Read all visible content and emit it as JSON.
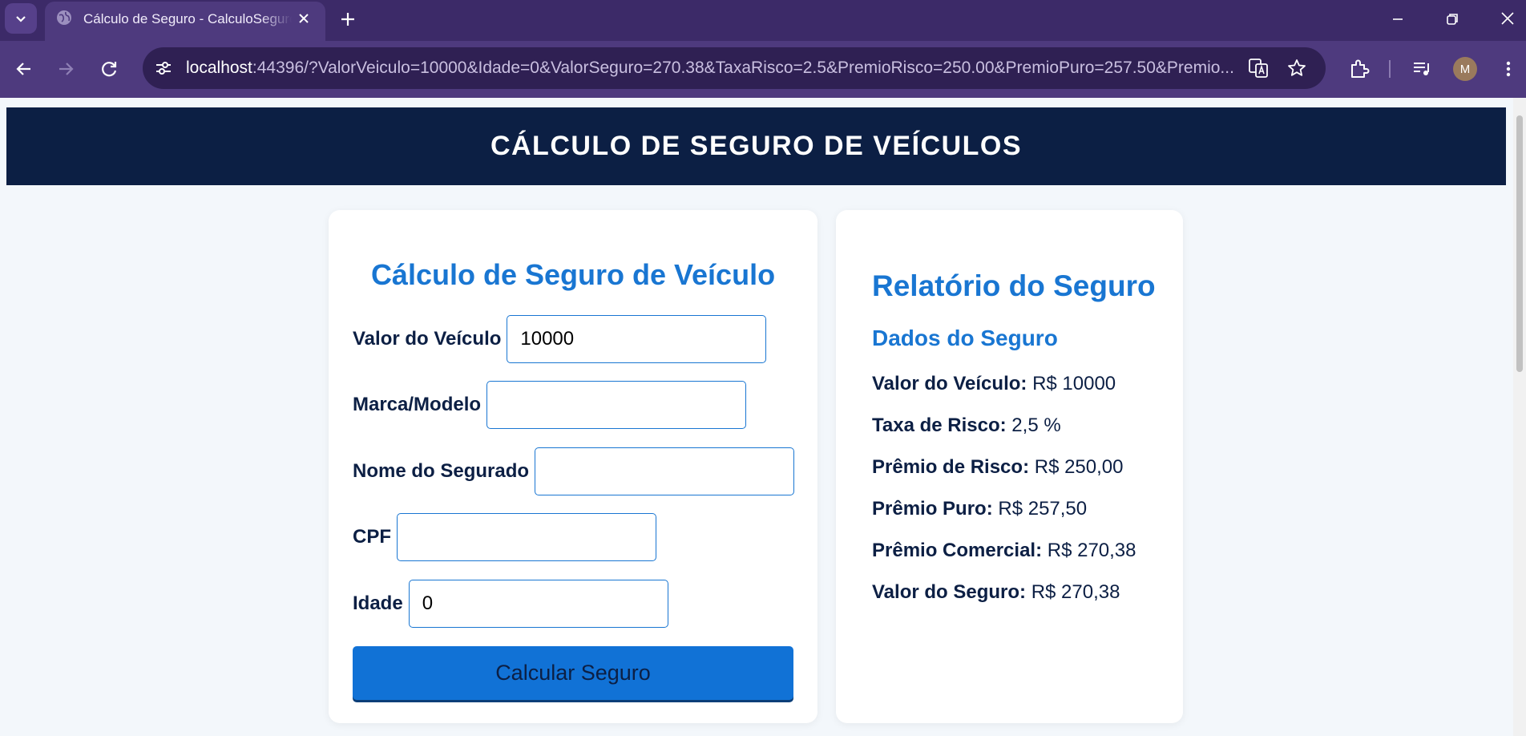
{
  "browser": {
    "tab_title": "Cálculo de Seguro - CalculoSeguro",
    "url_host": "localhost",
    "url_rest": ":44396/?ValorVeiculo=10000&Idade=0&ValorSeguro=270.38&TaxaRisco=2.5&PremioRisco=250.00&PremioPuro=257.50&Premio...",
    "profile_initial": "M",
    "icons": [
      "tab-search-icon",
      "globe-icon",
      "close-icon",
      "plus-icon",
      "minimize-icon",
      "restore-icon",
      "back-icon",
      "forward-icon",
      "reload-icon",
      "site-settings-icon",
      "translate-icon",
      "star-icon",
      "extensions-icon",
      "media-icon",
      "more-icon"
    ]
  },
  "page": {
    "header_title": "CÁLCULO DE SEGURO DE VEÍCULOS"
  },
  "form": {
    "title": "Cálculo de Seguro de Veículo",
    "fields": [
      {
        "label": "Valor do Veículo",
        "value": "10000"
      },
      {
        "label": "Marca/Modelo",
        "value": ""
      },
      {
        "label": "Nome do Segurado",
        "value": ""
      },
      {
        "label": "CPF",
        "value": ""
      },
      {
        "label": "Idade",
        "value": "0"
      }
    ],
    "submit_label": "Calcular Seguro"
  },
  "report": {
    "title": "Relatório do Seguro",
    "subtitle": "Dados do Seguro",
    "lines": [
      {
        "label": "Valor do Veículo:",
        "value": "R$ 10000"
      },
      {
        "label": "Taxa de Risco:",
        "value": "2,5 %"
      },
      {
        "label": "Prêmio de Risco:",
        "value": "R$ 250,00"
      },
      {
        "label": "Prêmio Puro:",
        "value": "R$ 257,50"
      },
      {
        "label": "Prêmio Comercial:",
        "value": "R$ 270,38"
      },
      {
        "label": "Valor do Seguro:",
        "value": "R$ 270,38"
      }
    ]
  },
  "colors": {
    "header_bg": "#0c1f44",
    "accent": "#1976d2",
    "button_bg": "#1172d6",
    "page_bg": "#f3f7fb",
    "browser_frame": "#3c2a68"
  }
}
